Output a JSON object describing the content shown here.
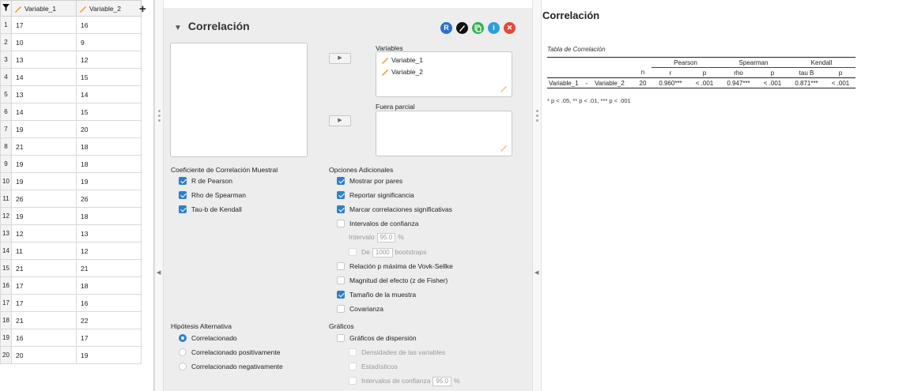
{
  "sheet": {
    "columns": [
      "Variable_1",
      "Variable_2"
    ],
    "rows": [
      [
        "1",
        "17",
        "16"
      ],
      [
        "2",
        "10",
        "9"
      ],
      [
        "3",
        "13",
        "12"
      ],
      [
        "4",
        "14",
        "15"
      ],
      [
        "5",
        "13",
        "14"
      ],
      [
        "6",
        "14",
        "15"
      ],
      [
        "7",
        "19",
        "20"
      ],
      [
        "8",
        "21",
        "18"
      ],
      [
        "9",
        "19",
        "18"
      ],
      [
        "10",
        "19",
        "19"
      ],
      [
        "11",
        "26",
        "26"
      ],
      [
        "12",
        "19",
        "18"
      ],
      [
        "13",
        "12",
        "13"
      ],
      [
        "14",
        "11",
        "12"
      ],
      [
        "15",
        "21",
        "21"
      ],
      [
        "16",
        "17",
        "18"
      ],
      [
        "17",
        "17",
        "16"
      ],
      [
        "18",
        "21",
        "22"
      ],
      [
        "19",
        "16",
        "17"
      ],
      [
        "20",
        "20",
        "19"
      ]
    ]
  },
  "panel": {
    "title": "Correlación",
    "variables_label": "Variables",
    "variables": [
      "Variable_1",
      "Variable_2"
    ],
    "partial_label": "Fuera parcial",
    "coef_heading": "Coeficiente de Correlación Muestral",
    "coef_options": [
      {
        "label": "R de Pearson",
        "checked": true
      },
      {
        "label": "Rho de Spearman",
        "checked": true
      },
      {
        "label": "Tau-b de Kendall",
        "checked": true
      }
    ],
    "extra_heading": "Opciones Adicionales",
    "extra": {
      "pairs": "Mostrar por pares",
      "signif": "Reportar significancia",
      "mark": "Marcar correlaciones significativas",
      "ci": "Intervalos de confianza",
      "interval_label": "Intervalo",
      "interval_value": "95.0",
      "interval_unit": "%",
      "from_label": "De",
      "bootstraps_value": "1000",
      "bootstraps_label": "bootstraps",
      "vs_mpr": "Relación p máxima de Vovk-Sellke",
      "effect": "Magnitud del efecto (z de Fisher)",
      "sample": "Tamaño de la muestra",
      "cov": "Covarianza"
    },
    "hyp_heading": "Hipótesis Alternativa",
    "hypotheses": [
      "Correlacionado",
      "Correlacionado positivamente",
      "Correlacionado negativamente"
    ],
    "plots_heading": "Gráficos",
    "plots": {
      "scatter": "Gráficos de dispersión",
      "densities": "Densidades de las variables",
      "stats": "Estadísticos",
      "ci": "Intervalos de confianza",
      "ci_value": "95.0",
      "ci_unit": "%"
    },
    "icons": {
      "r": "R",
      "accent_blue": "#2d7fd0"
    }
  },
  "results": {
    "title": "Correlación",
    "table_title": "Tabla de Correlación",
    "groups": [
      "Pearson",
      "Spearman",
      "Kendall"
    ],
    "headers": [
      "n",
      "r",
      "p",
      "rho",
      "p",
      "tau B",
      "p"
    ],
    "row": {
      "var1": "Variable_1",
      "dash": "-",
      "var2": "Variable_2",
      "n": "20",
      "r": "0.960***",
      "p1": "< .001",
      "rho": "0.947***",
      "p2": "< .001",
      "tau": "0.871***",
      "p3": "< .001"
    },
    "footnote": "* p < .05, ** p < .01, *** p < .001"
  }
}
